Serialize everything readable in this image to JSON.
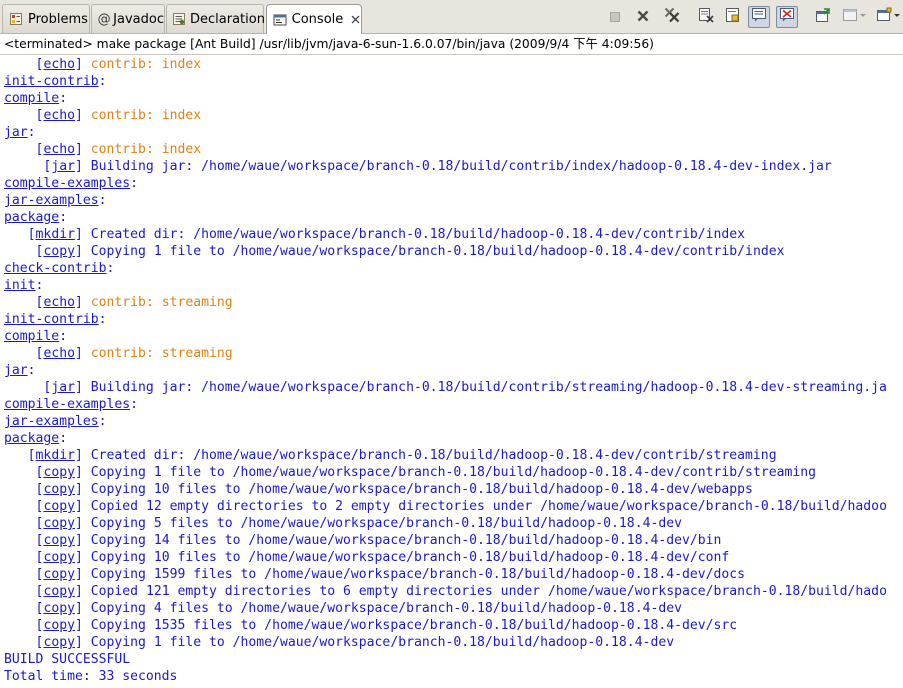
{
  "tabs": [
    {
      "label": "Problems",
      "icon": "problems-icon",
      "active": false
    },
    {
      "label": "Javadoc",
      "icon": "javadoc-icon",
      "active": false
    },
    {
      "label": "Declaration",
      "icon": "declaration-icon",
      "active": false
    },
    {
      "label": "Console",
      "icon": "console-icon",
      "active": true
    }
  ],
  "toolbar": {
    "icons": [
      "terminate-icon",
      "remove-launch-icon",
      "remove-all-terminated-icon",
      "clear-console-icon",
      "scroll-lock-icon",
      "show-stdout-icon",
      "show-stderr-icon",
      "pin-console-icon",
      "display-console-icon",
      "open-console-icon"
    ]
  },
  "status": "<terminated> make package [Ant Build] /usr/lib/jvm/java-6-sun-1.6.0.07/bin/java (2009/9/4 下午 4:09:56)",
  "colors": {
    "link": "#1a1ac8",
    "echo": "#e08214",
    "tabbar_bg": "#e8e5df"
  },
  "console_lines": [
    {
      "kind": "task",
      "indent": "    ",
      "task": "echo",
      "text": " contrib: index",
      "echo": true
    },
    {
      "kind": "target",
      "target": "init-contrib"
    },
    {
      "kind": "target",
      "target": "compile"
    },
    {
      "kind": "task",
      "indent": "    ",
      "task": "echo",
      "text": " contrib: index",
      "echo": true
    },
    {
      "kind": "target",
      "target": "jar"
    },
    {
      "kind": "task",
      "indent": "    ",
      "task": "echo",
      "text": " contrib: index",
      "echo": true
    },
    {
      "kind": "task",
      "indent": "     ",
      "task": "jar",
      "text": " Building jar: /home/waue/workspace/branch-0.18/build/contrib/index/hadoop-0.18.4-dev-index.jar",
      "echo": false
    },
    {
      "kind": "target",
      "target": "compile-examples"
    },
    {
      "kind": "target",
      "target": "jar-examples"
    },
    {
      "kind": "target",
      "target": "package"
    },
    {
      "kind": "task",
      "indent": "   ",
      "task": "mkdir",
      "text": " Created dir: /home/waue/workspace/branch-0.18/build/hadoop-0.18.4-dev/contrib/index",
      "echo": false
    },
    {
      "kind": "task",
      "indent": "    ",
      "task": "copy",
      "text": " Copying 1 file to /home/waue/workspace/branch-0.18/build/hadoop-0.18.4-dev/contrib/index",
      "echo": false
    },
    {
      "kind": "target",
      "target": "check-contrib"
    },
    {
      "kind": "target",
      "target": "init"
    },
    {
      "kind": "task",
      "indent": "    ",
      "task": "echo",
      "text": " contrib: streaming",
      "echo": true
    },
    {
      "kind": "target",
      "target": "init-contrib"
    },
    {
      "kind": "target",
      "target": "compile"
    },
    {
      "kind": "task",
      "indent": "    ",
      "task": "echo",
      "text": " contrib: streaming",
      "echo": true
    },
    {
      "kind": "target",
      "target": "jar"
    },
    {
      "kind": "task",
      "indent": "     ",
      "task": "jar",
      "text": " Building jar: /home/waue/workspace/branch-0.18/build/contrib/streaming/hadoop-0.18.4-dev-streaming.ja",
      "echo": false
    },
    {
      "kind": "target",
      "target": "compile-examples"
    },
    {
      "kind": "target",
      "target": "jar-examples"
    },
    {
      "kind": "target",
      "target": "package"
    },
    {
      "kind": "task",
      "indent": "   ",
      "task": "mkdir",
      "text": " Created dir: /home/waue/workspace/branch-0.18/build/hadoop-0.18.4-dev/contrib/streaming",
      "echo": false
    },
    {
      "kind": "task",
      "indent": "    ",
      "task": "copy",
      "text": " Copying 1 file to /home/waue/workspace/branch-0.18/build/hadoop-0.18.4-dev/contrib/streaming",
      "echo": false
    },
    {
      "kind": "task",
      "indent": "    ",
      "task": "copy",
      "text": " Copying 10 files to /home/waue/workspace/branch-0.18/build/hadoop-0.18.4-dev/webapps",
      "echo": false
    },
    {
      "kind": "task",
      "indent": "    ",
      "task": "copy",
      "text": " Copied 12 empty directories to 2 empty directories under /home/waue/workspace/branch-0.18/build/hadoo",
      "echo": false
    },
    {
      "kind": "task",
      "indent": "    ",
      "task": "copy",
      "text": " Copying 5 files to /home/waue/workspace/branch-0.18/build/hadoop-0.18.4-dev",
      "echo": false
    },
    {
      "kind": "task",
      "indent": "    ",
      "task": "copy",
      "text": " Copying 14 files to /home/waue/workspace/branch-0.18/build/hadoop-0.18.4-dev/bin",
      "echo": false
    },
    {
      "kind": "task",
      "indent": "    ",
      "task": "copy",
      "text": " Copying 10 files to /home/waue/workspace/branch-0.18/build/hadoop-0.18.4-dev/conf",
      "echo": false
    },
    {
      "kind": "task",
      "indent": "    ",
      "task": "copy",
      "text": " Copying 1599 files to /home/waue/workspace/branch-0.18/build/hadoop-0.18.4-dev/docs",
      "echo": false
    },
    {
      "kind": "task",
      "indent": "    ",
      "task": "copy",
      "text": " Copied 121 empty directories to 6 empty directories under /home/waue/workspace/branch-0.18/build/hado",
      "echo": false
    },
    {
      "kind": "task",
      "indent": "    ",
      "task": "copy",
      "text": " Copying 4 files to /home/waue/workspace/branch-0.18/build/hadoop-0.18.4-dev",
      "echo": false
    },
    {
      "kind": "task",
      "indent": "    ",
      "task": "copy",
      "text": " Copying 1535 files to /home/waue/workspace/branch-0.18/build/hadoop-0.18.4-dev/src",
      "echo": false
    },
    {
      "kind": "task",
      "indent": "    ",
      "task": "copy",
      "text": " Copying 1 file to /home/waue/workspace/branch-0.18/build/hadoop-0.18.4-dev",
      "echo": false
    },
    {
      "kind": "plain",
      "text": "BUILD SUCCESSFUL"
    },
    {
      "kind": "plain",
      "text": "Total time: 33 seconds"
    }
  ]
}
